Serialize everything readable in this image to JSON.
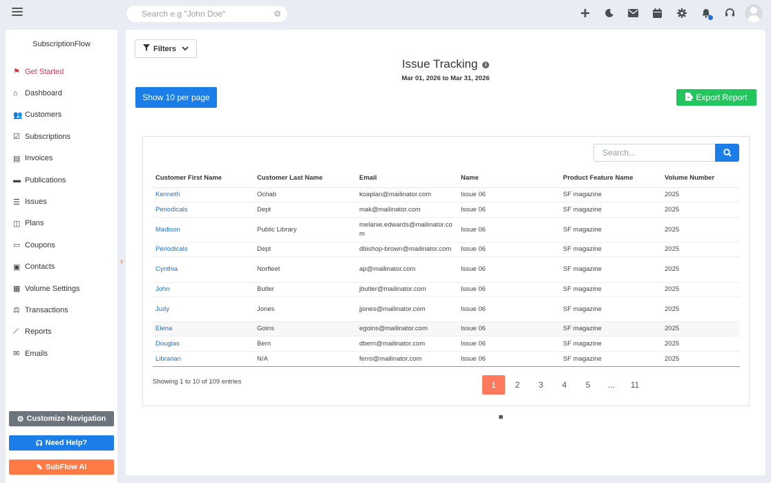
{
  "topbar": {
    "search_placeholder": "Search e.g \"John Doe\""
  },
  "sidebar": {
    "brand": "SubscriptionFlow",
    "items": [
      {
        "label": "Get Started",
        "icon": "flag-icon"
      },
      {
        "label": "Dashboard",
        "icon": "home-icon"
      },
      {
        "label": "Customers",
        "icon": "users-icon"
      },
      {
        "label": "Subscriptions",
        "icon": "calendar-check-icon"
      },
      {
        "label": "Invoices",
        "icon": "file-invoice-icon"
      },
      {
        "label": "Publications",
        "icon": "box-icon"
      },
      {
        "label": "Issues",
        "icon": "list-icon"
      },
      {
        "label": "Plans",
        "icon": "columns-icon"
      },
      {
        "label": "Coupons",
        "icon": "ticket-icon"
      },
      {
        "label": "Contacts",
        "icon": "address-card-icon"
      },
      {
        "label": "Volume Settings",
        "icon": "archive-icon"
      },
      {
        "label": "Transactions",
        "icon": "hand-coins-icon"
      },
      {
        "label": "Reports",
        "icon": "chart-line-icon"
      },
      {
        "label": "Emails",
        "icon": "envelope-icon"
      }
    ],
    "customize_label": "Customize Navigation",
    "help_label": "Need Help?",
    "ai_label": "SubFlow AI"
  },
  "main": {
    "filters_label": "Filters",
    "title": "Issue Tracking",
    "date_range": "Mar 01, 2026 to Mar 31, 2026",
    "per_page_label": "Show 10 per page",
    "export_label": "Export Report",
    "table_search_placeholder": "Search...",
    "columns": [
      "Customer First Name",
      "Customer Last Name",
      "Email",
      "Name",
      "Product Feature Name",
      "Volume Number"
    ],
    "rows": [
      [
        "Kenneth",
        "Ochab",
        "koaplan@mailinator.com",
        "Issue 06",
        "SF magazine",
        "2025"
      ],
      [
        "Periodicals",
        "Dept",
        "mak@mailinator.com",
        "Issue 06",
        "SF magazine",
        "2025"
      ],
      [
        "Madison",
        "Public Library",
        "melanie.edwards@mailinator.com",
        "Issue 06",
        "SF magazine",
        "2025"
      ],
      [
        "Periodicals",
        "Dept",
        "dbishop-brown@mailinator.com",
        "Issue 06",
        "SF magazine",
        "2025"
      ],
      [
        "Cynthia",
        "Norfleet",
        "ap@mailinator.com",
        "Issue 06",
        "SF magazine",
        "2025"
      ],
      [
        "John",
        "Butler",
        "jbutler@mailinator.com",
        "Issue 06",
        "SF magazine",
        "2025"
      ],
      [
        "Judy",
        "Jones",
        "jjones@mailinator.com",
        "Issue 06",
        "SF magazine",
        "2025"
      ],
      [
        "Elena",
        "Goins",
        "egoins@mailinator.com",
        "Issue 06",
        "SF magazine",
        "2025"
      ],
      [
        "Douglas",
        "Bern",
        "dbern@mailinator.com",
        "Issue 06",
        "SF magazine",
        "2025"
      ],
      [
        "Librarian",
        "N/A",
        "ferro@mailinator.com",
        "Issue 06",
        "SF magazine",
        "2025"
      ]
    ],
    "showing_text": "Showing 1 to 10 of 109 entries",
    "pagination": [
      "«",
      "‹",
      "1",
      "2",
      "3",
      "4",
      "5",
      "...",
      "11",
      "›",
      "»"
    ],
    "current_page": "1"
  },
  "colors": {
    "primary": "#1a7de8",
    "success": "#22c55e",
    "accent": "#ff7a45",
    "active_nav": "#e0314b"
  }
}
